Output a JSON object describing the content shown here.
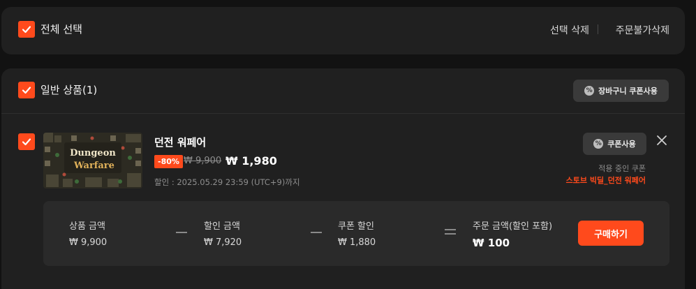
{
  "colors": {
    "accent": "#ff4a1c",
    "panel": "#202020",
    "background": "#121212"
  },
  "top_bar": {
    "select_all_label": "전체 선택",
    "delete_selected": "선택 삭제",
    "delete_unavailable": "주문불가삭제"
  },
  "group": {
    "label": "일반 상품(1)",
    "cart_coupon_button": "장바구니 쿠폰사용"
  },
  "item": {
    "thumbnail_title_line1": "Dungeon",
    "thumbnail_title_line2": "Warfare",
    "name": "던전 워페어",
    "discount_badge": "-80%",
    "original_price": "₩ 9,900",
    "sale_price": "₩ 1,980",
    "sale_period": "할인 : 2025.05.29 23:59 (UTC+9)까지",
    "coupon_button": "쿠폰사용",
    "applied_coupon_label": "적용 중인 쿠폰",
    "applied_coupon_name": "스토브 빅딜_던전 워페어"
  },
  "summary": {
    "product_amount_label": "상품 금액",
    "product_amount": "₩ 9,900",
    "discount_amount_label": "할인 금액",
    "discount_amount": "₩ 7,920",
    "coupon_discount_label": "쿠폰 할인",
    "coupon_discount": "₩ 1,880",
    "order_amount_label": "주문 금액(할인 포함)",
    "order_amount": "₩ 100",
    "buy_button": "구매하기"
  },
  "icons": [
    "check-icon",
    "coupon-icon",
    "close-icon"
  ]
}
